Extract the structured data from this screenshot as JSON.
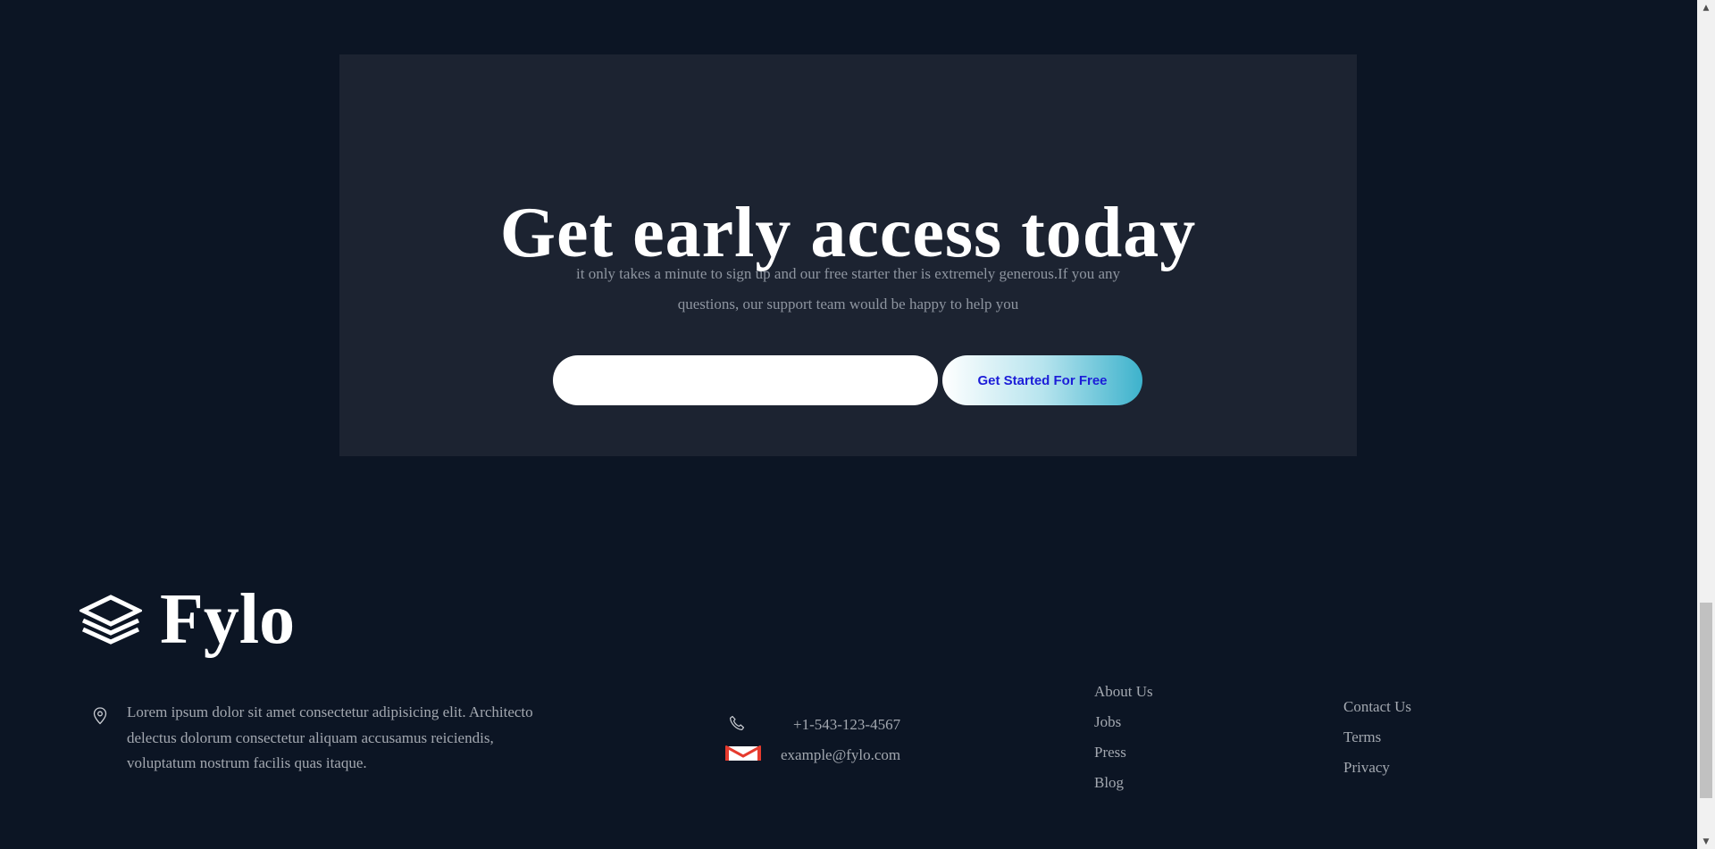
{
  "cta": {
    "title": "Get early access today",
    "description": "it only takes a minute to sign up and our free starter ther is extremely generous.If you any questions, our support team would be happy to help you",
    "email_value": "",
    "email_placeholder": "",
    "button_label": "Get Started For Free"
  },
  "footer": {
    "brand_name": "Fylo",
    "logo_icon": "stacked-layers-icon",
    "address": "Lorem ipsum dolor sit amet consectetur adipisicing elit. Architecto delectus dolorum consectetur aliquam accusamus reiciendis, voluptatum nostrum facilis quas itaque.",
    "phone": "+1-543-123-4567",
    "email": "example@fylo.com",
    "links_col1": [
      "About Us",
      "Jobs",
      "Press",
      "Blog"
    ],
    "links_col2": [
      "Contact Us",
      "Terms",
      "Privacy"
    ]
  },
  "colors": {
    "page_background": "#0c1524",
    "card_background": "#1c2331",
    "muted_text": "#a3a8b0",
    "button_text": "#1c1dd8",
    "button_gradient_end": "#3db2cc"
  },
  "scrollbar": {
    "up_arrow": "▲",
    "down_arrow": "▼"
  }
}
